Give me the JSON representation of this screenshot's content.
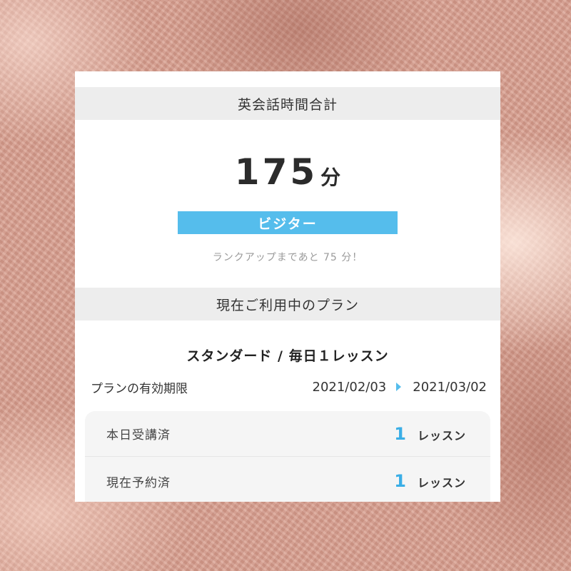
{
  "summary": {
    "header": "英会話時間合計",
    "total_value": "175",
    "total_unit": "分",
    "rank": "ビジター",
    "rankup_message": "ランクアップまであと 75 分！"
  },
  "plan": {
    "header": "現在ご利用中のプラン",
    "name": "スタンダード / 毎日１レッスン",
    "period_label": "プランの有効期限",
    "period_start": "2021/02/03",
    "period_end": "2021/03/02"
  },
  "lessons": [
    {
      "label": "本日受講済",
      "count": "1",
      "unit": "レッスン"
    },
    {
      "label": "現在予約済",
      "count": "1",
      "unit": "レッスン"
    }
  ],
  "colors": {
    "accent": "#55bdec",
    "count": "#3aaee6",
    "header_bg": "#ededed"
  },
  "icons": {
    "period_arrow": "play-arrow-icon"
  }
}
